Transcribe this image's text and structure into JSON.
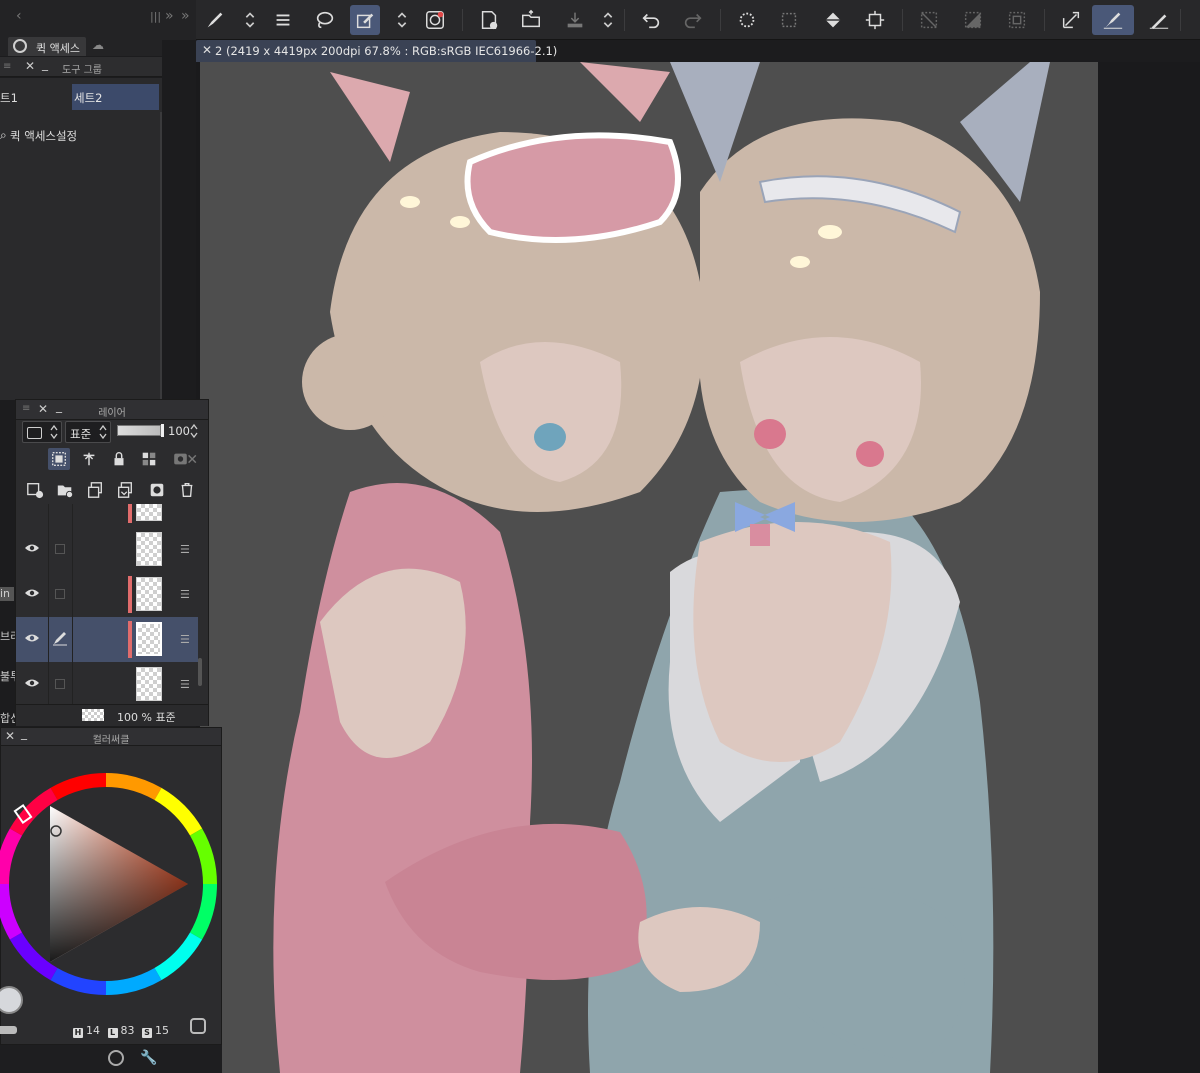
{
  "document": {
    "tab_title": "2 (2419 x 4419px 200dpi 67.8% : RGB:sRGB IEC61966-2.1)"
  },
  "quick_access": {
    "tab_label": "퀵 액세스",
    "tool_group_label": "도구 그룹",
    "set1_label": "트1",
    "set2_label": "세트2",
    "setting_label": "퀵 액세스설정"
  },
  "layer_panel": {
    "title": "레이어",
    "blend_mode": "표준",
    "opacity": "100",
    "footer_value": "100 % 표준"
  },
  "cut_labels": {
    "a": "in",
    "b": "브리",
    "c": "불투",
    "d": "합신"
  },
  "color_panel": {
    "title": "컬러써클",
    "h_label": "H",
    "h_value": "14",
    "l_label": "L",
    "l_value": "83",
    "s_label": "S",
    "s_value": "15"
  },
  "colors": {
    "accent": "#4a5878",
    "layer_marker": "#e06c6c",
    "canvas_bg": "#4e4e4e"
  }
}
